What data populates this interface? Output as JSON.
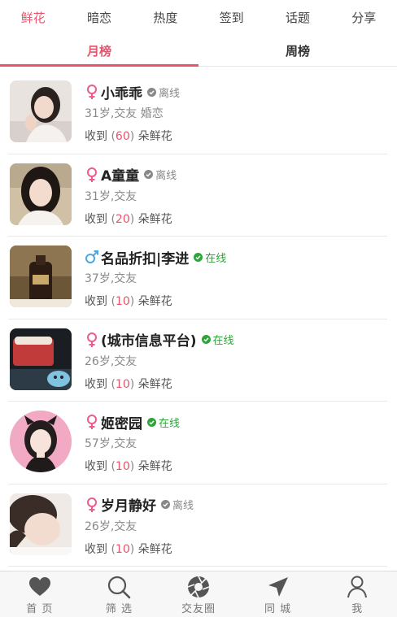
{
  "colors": {
    "accent": "#e8546b",
    "female": "#ec5b8b",
    "male": "#4aa8e0",
    "online": "#2ea43a",
    "offline": "#888888"
  },
  "top_tabs": [
    {
      "label": "鲜花",
      "active": true
    },
    {
      "label": "暗恋"
    },
    {
      "label": "热度"
    },
    {
      "label": "签到"
    },
    {
      "label": "话题"
    },
    {
      "label": "分享"
    }
  ],
  "sub_tabs": [
    {
      "label": "月榜",
      "active": true
    },
    {
      "label": "周榜"
    }
  ],
  "list": [
    {
      "name": "小乖乖",
      "gender": "female",
      "status": "离线",
      "online": false,
      "detail": "31岁,交友 婚恋",
      "received_label": "收到",
      "count": "60",
      "unit": "朵鲜花"
    },
    {
      "name": "A童童",
      "gender": "female",
      "status": "离线",
      "online": false,
      "detail": "31岁,交友",
      "received_label": "收到",
      "count": "20",
      "unit": "朵鲜花"
    },
    {
      "name": "名品折扣|李进",
      "gender": "male",
      "status": "在线",
      "online": true,
      "detail": "37岁,交友",
      "received_label": "收到",
      "count": "10",
      "unit": "朵鲜花"
    },
    {
      "name": "(城市信息平台)",
      "gender": "female",
      "status": "在线",
      "online": true,
      "detail": "26岁,交友",
      "received_label": "收到",
      "count": "10",
      "unit": "朵鲜花"
    },
    {
      "name": "姬密园",
      "gender": "female",
      "status": "在线",
      "online": true,
      "detail": "57岁,交友",
      "received_label": "收到",
      "count": "10",
      "unit": "朵鲜花"
    },
    {
      "name": "岁月静好",
      "gender": "female",
      "status": "离线",
      "online": false,
      "detail": "26岁,交友",
      "received_label": "收到",
      "count": "10",
      "unit": "朵鲜花"
    }
  ],
  "bottom_nav": [
    {
      "label": "首 页",
      "icon": "heart-icon"
    },
    {
      "label": "筛 选",
      "icon": "search-icon"
    },
    {
      "label": "交友圈",
      "icon": "aperture-icon"
    },
    {
      "label": "同 城",
      "icon": "location-arrow-icon"
    },
    {
      "label": "我",
      "icon": "user-icon"
    }
  ]
}
